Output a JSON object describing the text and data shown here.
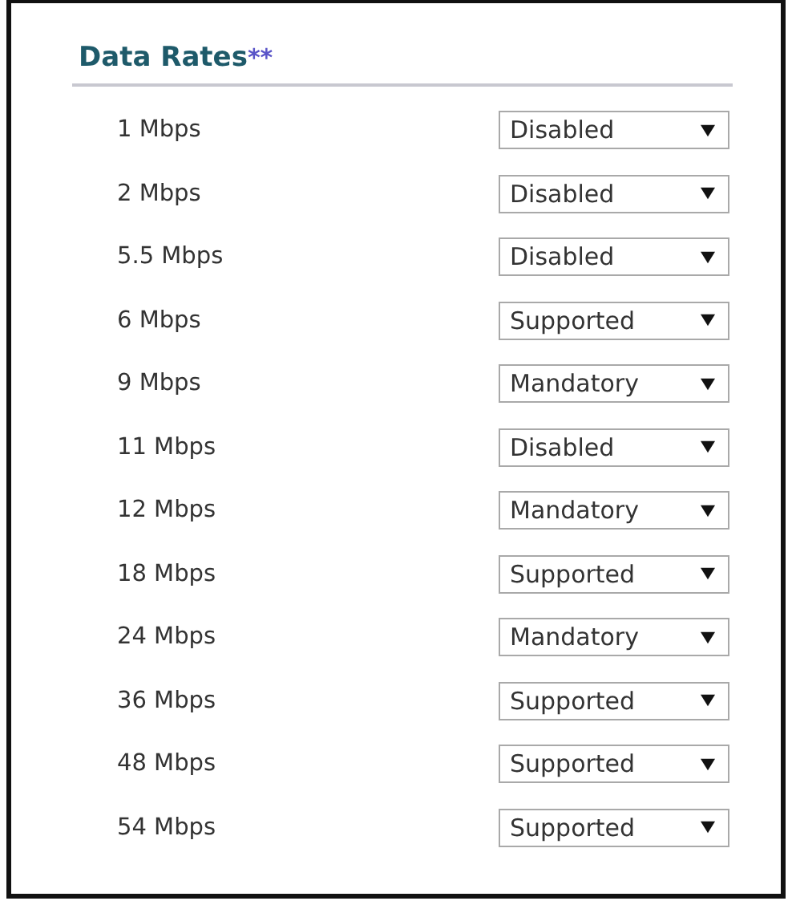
{
  "section": {
    "title": "Data Rates",
    "title_mark": "**"
  },
  "rates": [
    {
      "label": "1 Mbps",
      "value": "Disabled"
    },
    {
      "label": "2 Mbps",
      "value": "Disabled"
    },
    {
      "label": "5.5 Mbps",
      "value": "Disabled"
    },
    {
      "label": "6 Mbps",
      "value": "Supported"
    },
    {
      "label": "9 Mbps",
      "value": "Mandatory"
    },
    {
      "label": "11 Mbps",
      "value": "Disabled"
    },
    {
      "label": "12 Mbps",
      "value": "Mandatory"
    },
    {
      "label": "18 Mbps",
      "value": "Supported"
    },
    {
      "label": "24 Mbps",
      "value": "Mandatory"
    },
    {
      "label": "36 Mbps",
      "value": "Supported"
    },
    {
      "label": "48 Mbps",
      "value": "Supported"
    },
    {
      "label": "54 Mbps",
      "value": "Supported"
    }
  ]
}
